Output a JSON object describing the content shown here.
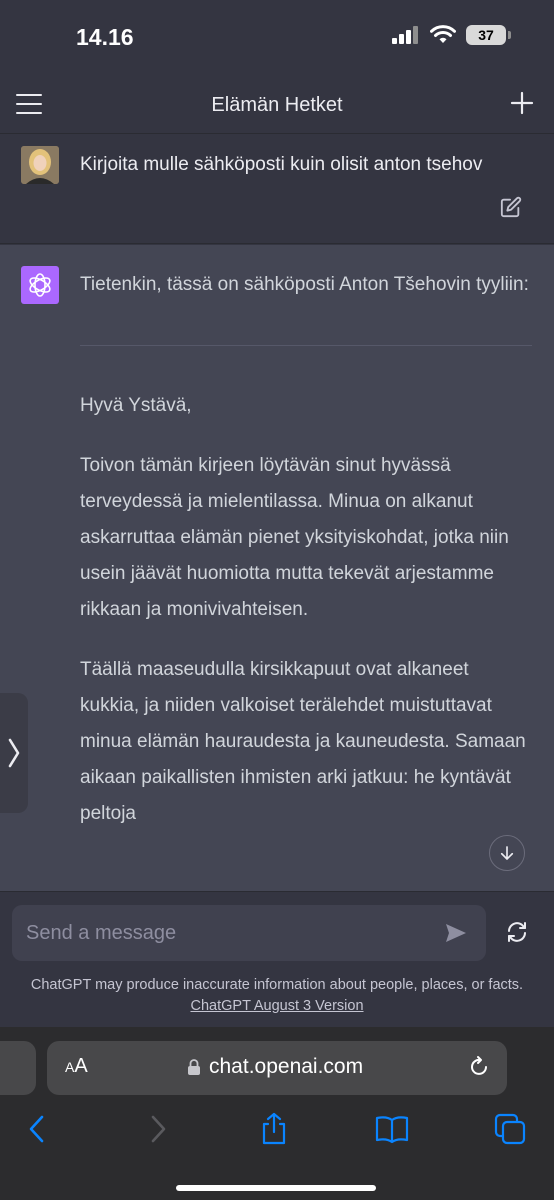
{
  "status_bar": {
    "time": "14.16",
    "battery": "37"
  },
  "nav": {
    "title": "Elämän Hetket"
  },
  "user_message": {
    "text": "Kirjoita mulle sähköposti kuin olisit anton tsehov"
  },
  "assistant_message": {
    "intro": "Tietenkin, tässä on sähköposti Anton Tšehovin tyyliin:",
    "greeting": "Hyvä Ystävä,",
    "paragraph_1": "Toivon tämän kirjeen löytävän sinut hyvässä terveydessä ja mielentilassa. Minua on alkanut askarruttaa elämän pienet yksityiskohdat, jotka niin usein jäävät huomiotta mutta tekevät arjestamme rikkaan ja monivivahteisen.",
    "paragraph_2": "Täällä maaseudulla kirsikkapuut ovat alkaneet kukkia, ja niiden valkoiset terälehdet muistuttavat minua elämän hauraudesta ja kauneudesta. Samaan aikaan paikallisten ihmisten arki jatkuu: he kyntävät peltoja"
  },
  "composer": {
    "placeholder": "Send a message",
    "disclaimer": "ChatGPT may produce inaccurate information about people, places, or facts.",
    "version_link": "ChatGPT August 3 Version"
  },
  "browser": {
    "aa_small": "A",
    "aa_large": "A",
    "url": "chat.openai.com"
  },
  "colors": {
    "background": "#343541",
    "assistant_bg": "#444654",
    "accent": "#ab68ff",
    "link_blue": "#0a84ff"
  },
  "icons": [
    "hamburger-icon",
    "plus-icon",
    "edit-icon",
    "openai-logo-icon",
    "chevron-down-icon",
    "chevron-right-icon",
    "send-icon",
    "regenerate-icon",
    "lock-icon",
    "reload-icon",
    "back-icon",
    "forward-icon",
    "share-icon",
    "bookmarks-icon",
    "tabs-icon"
  ]
}
